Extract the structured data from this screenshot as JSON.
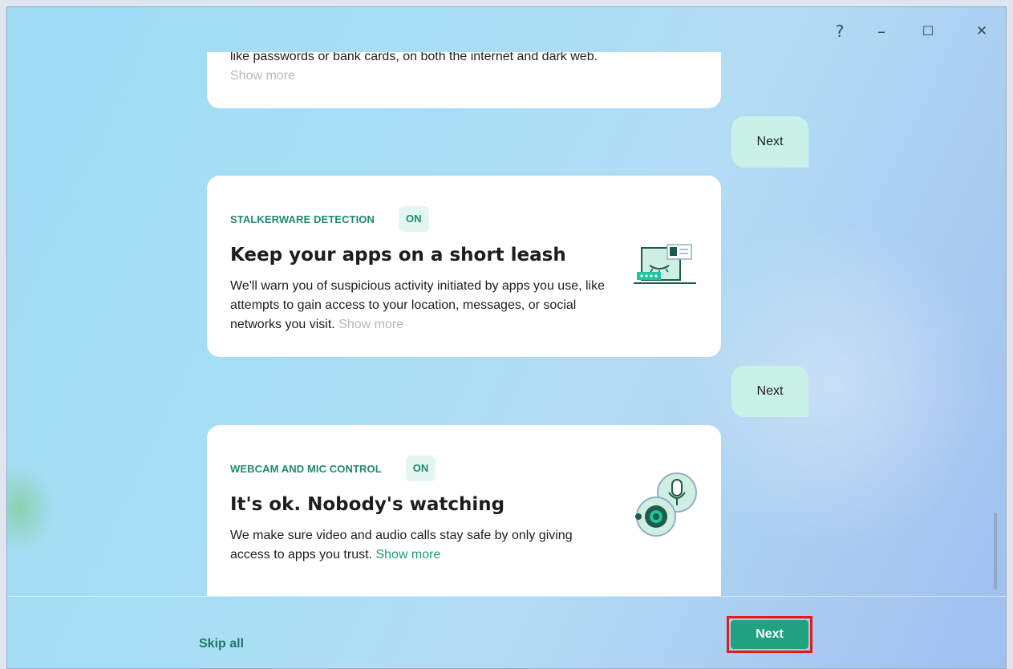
{
  "titlebar": {
    "help": "?",
    "minimize": "–",
    "maximize": "☐",
    "close": "✕"
  },
  "top_card": {
    "text": "like passwords or bank cards, on both the internet and dark web.",
    "show_more": "Show more"
  },
  "replies": [
    "Next",
    "Next"
  ],
  "cards": [
    {
      "tag": "STALKERWARE DETECTION",
      "status": "ON",
      "title": "Keep your apps on a short leash",
      "description": "We'll warn you of suspicious activity initiated by apps you use, like attempts to gain access to your location, messages, or social networks you visit.",
      "show_more": "Show more",
      "icon": "laptop-eye-icon"
    },
    {
      "tag": "WEBCAM AND MIC CONTROL",
      "status": "ON",
      "title": "It's ok. Nobody's watching",
      "description": "We make sure video and audio calls stay safe by only giving access to apps you trust.",
      "show_more": "Show more",
      "icon": "webcam-mic-icon"
    }
  ],
  "footer": {
    "skip_label": "Skip all",
    "next_label": "Next"
  },
  "colors": {
    "accent": "#20a27e",
    "tag_green": "#1f8a6e",
    "reply_bg": "#c9f1e7",
    "highlight": "#e21b1b"
  }
}
